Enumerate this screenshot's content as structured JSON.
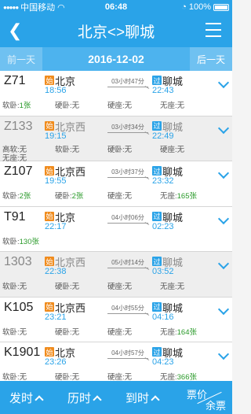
{
  "status": {
    "carrier": "中国移动",
    "time": "06:48",
    "battery": "100%"
  },
  "nav": {
    "title": "北京<>聊城"
  },
  "date_bar": {
    "prev": "前一天",
    "date": "2016-12-02",
    "next": "后一天"
  },
  "badges": {
    "start": "始",
    "pass": "过"
  },
  "trains": [
    {
      "code": "Z71",
      "from": "北京",
      "to": "聊城",
      "dep": "18:56",
      "arr": "22:43",
      "duration": "03小时47分",
      "seats": [
        [
          "软卧:1张",
          "硬卧:无",
          "硬座:无",
          "无座:无"
        ]
      ],
      "style": "normal"
    },
    {
      "code": "Z133",
      "from": "北京西",
      "to": "聊城",
      "dep": "19:15",
      "arr": "22:49",
      "duration": "03小时34分",
      "seats": [
        [
          "高软:无",
          "软卧:无",
          "硬卧:无",
          "硬座:无"
        ],
        [
          "无座:无"
        ]
      ],
      "style": "gray"
    },
    {
      "code": "Z107",
      "from": "北京西",
      "to": "聊城",
      "dep": "19:55",
      "arr": "23:32",
      "duration": "03小时37分",
      "seats": [
        [
          "软卧:2张",
          "硬卧:2张",
          "硬座:无",
          "无座:165张"
        ]
      ],
      "style": "normal"
    },
    {
      "code": "T91",
      "from": "北京",
      "to": "聊城",
      "dep": "22:17",
      "arr": "02:23",
      "duration": "04小时06分",
      "seats": [
        [
          "软卧:130张"
        ]
      ],
      "style": "normal"
    },
    {
      "code": "1303",
      "from": "北京西",
      "to": "聊城",
      "dep": "22:38",
      "arr": "03:52",
      "duration": "05小时14分",
      "seats": [
        [
          "软卧:无",
          "硬卧:无",
          "硬座:无",
          "无座:无"
        ]
      ],
      "style": "gray"
    },
    {
      "code": "K105",
      "from": "北京西",
      "to": "聊城",
      "dep": "23:21",
      "arr": "04:16",
      "duration": "04小时55分",
      "seats": [
        [
          "软卧:无",
          "硬卧:无",
          "硬座:无",
          "无座:164张"
        ]
      ],
      "style": "normal"
    },
    {
      "code": "K1901",
      "from": "北京",
      "to": "聊城",
      "dep": "23:26",
      "arr": "04:23",
      "duration": "04小时57分",
      "seats": [
        [
          "软卧:无",
          "硬卧:无",
          "硬座:无",
          "无座:366张"
        ]
      ],
      "style": "normal"
    }
  ],
  "footer": {
    "depart": "发时",
    "duration": "历时",
    "arrive": "到时",
    "price": "票价",
    "remain": "余票"
  },
  "colors": {
    "primary": "#2aa3e8",
    "start_badge": "#f08c1e",
    "available": "#2a9a2a"
  }
}
